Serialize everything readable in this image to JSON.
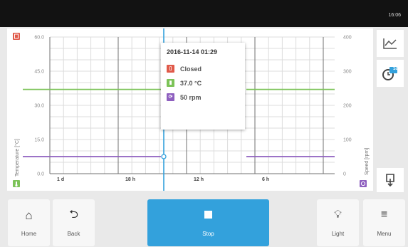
{
  "status_bar": {
    "time": "16:06"
  },
  "chart": {
    "left_axis": {
      "title": "Temperature [°C]",
      "ticks": [
        "60.0",
        "45.0",
        "30.0",
        "15.0",
        "0.0"
      ]
    },
    "right_axis": {
      "title": "Speed [rpm]",
      "ticks": [
        "400",
        "300",
        "200",
        "100",
        "0"
      ]
    },
    "time_labels": [
      "1 d",
      "18 h",
      "12 h",
      "6 h"
    ]
  },
  "chart_data": {
    "type": "line",
    "x_labels": [
      "1 d",
      "18 h",
      "12 h",
      "6 h"
    ],
    "ylabel": "Temperature [°C]",
    "ylabel_right": "Speed [rpm]",
    "ylim": [
      0,
      60
    ],
    "ylim_right": [
      0,
      400
    ],
    "grid": true,
    "series": [
      {
        "axis": "left",
        "value": 37.0,
        "color": "#7cc358"
      },
      {
        "axis": "right",
        "value": 50,
        "color": "#8e5fbf"
      }
    ],
    "cursor": {
      "label": "2016-11-14 01:29"
    }
  },
  "tooltip": {
    "timestamp": "2016-11-14 01:29",
    "items": [
      {
        "icon": "door-icon",
        "text": "Closed",
        "color": "#e05a4a"
      },
      {
        "icon": "thermometer-icon",
        "text": "37.0 °C",
        "color": "#7cc358"
      },
      {
        "icon": "rotation-icon",
        "text": "50 rpm",
        "color": "#8e5fbf"
      }
    ]
  },
  "side": {
    "badge": "1d"
  },
  "footer": {
    "home": "Home",
    "back": "Back",
    "stop": "Stop",
    "light": "Light",
    "menu": "Menu"
  },
  "colors": {
    "accent": "#33a1dc",
    "temperature": "#7cc358",
    "speed": "#8e5fbf",
    "door": "#e05a4a",
    "cursor": "#33a1dc"
  }
}
